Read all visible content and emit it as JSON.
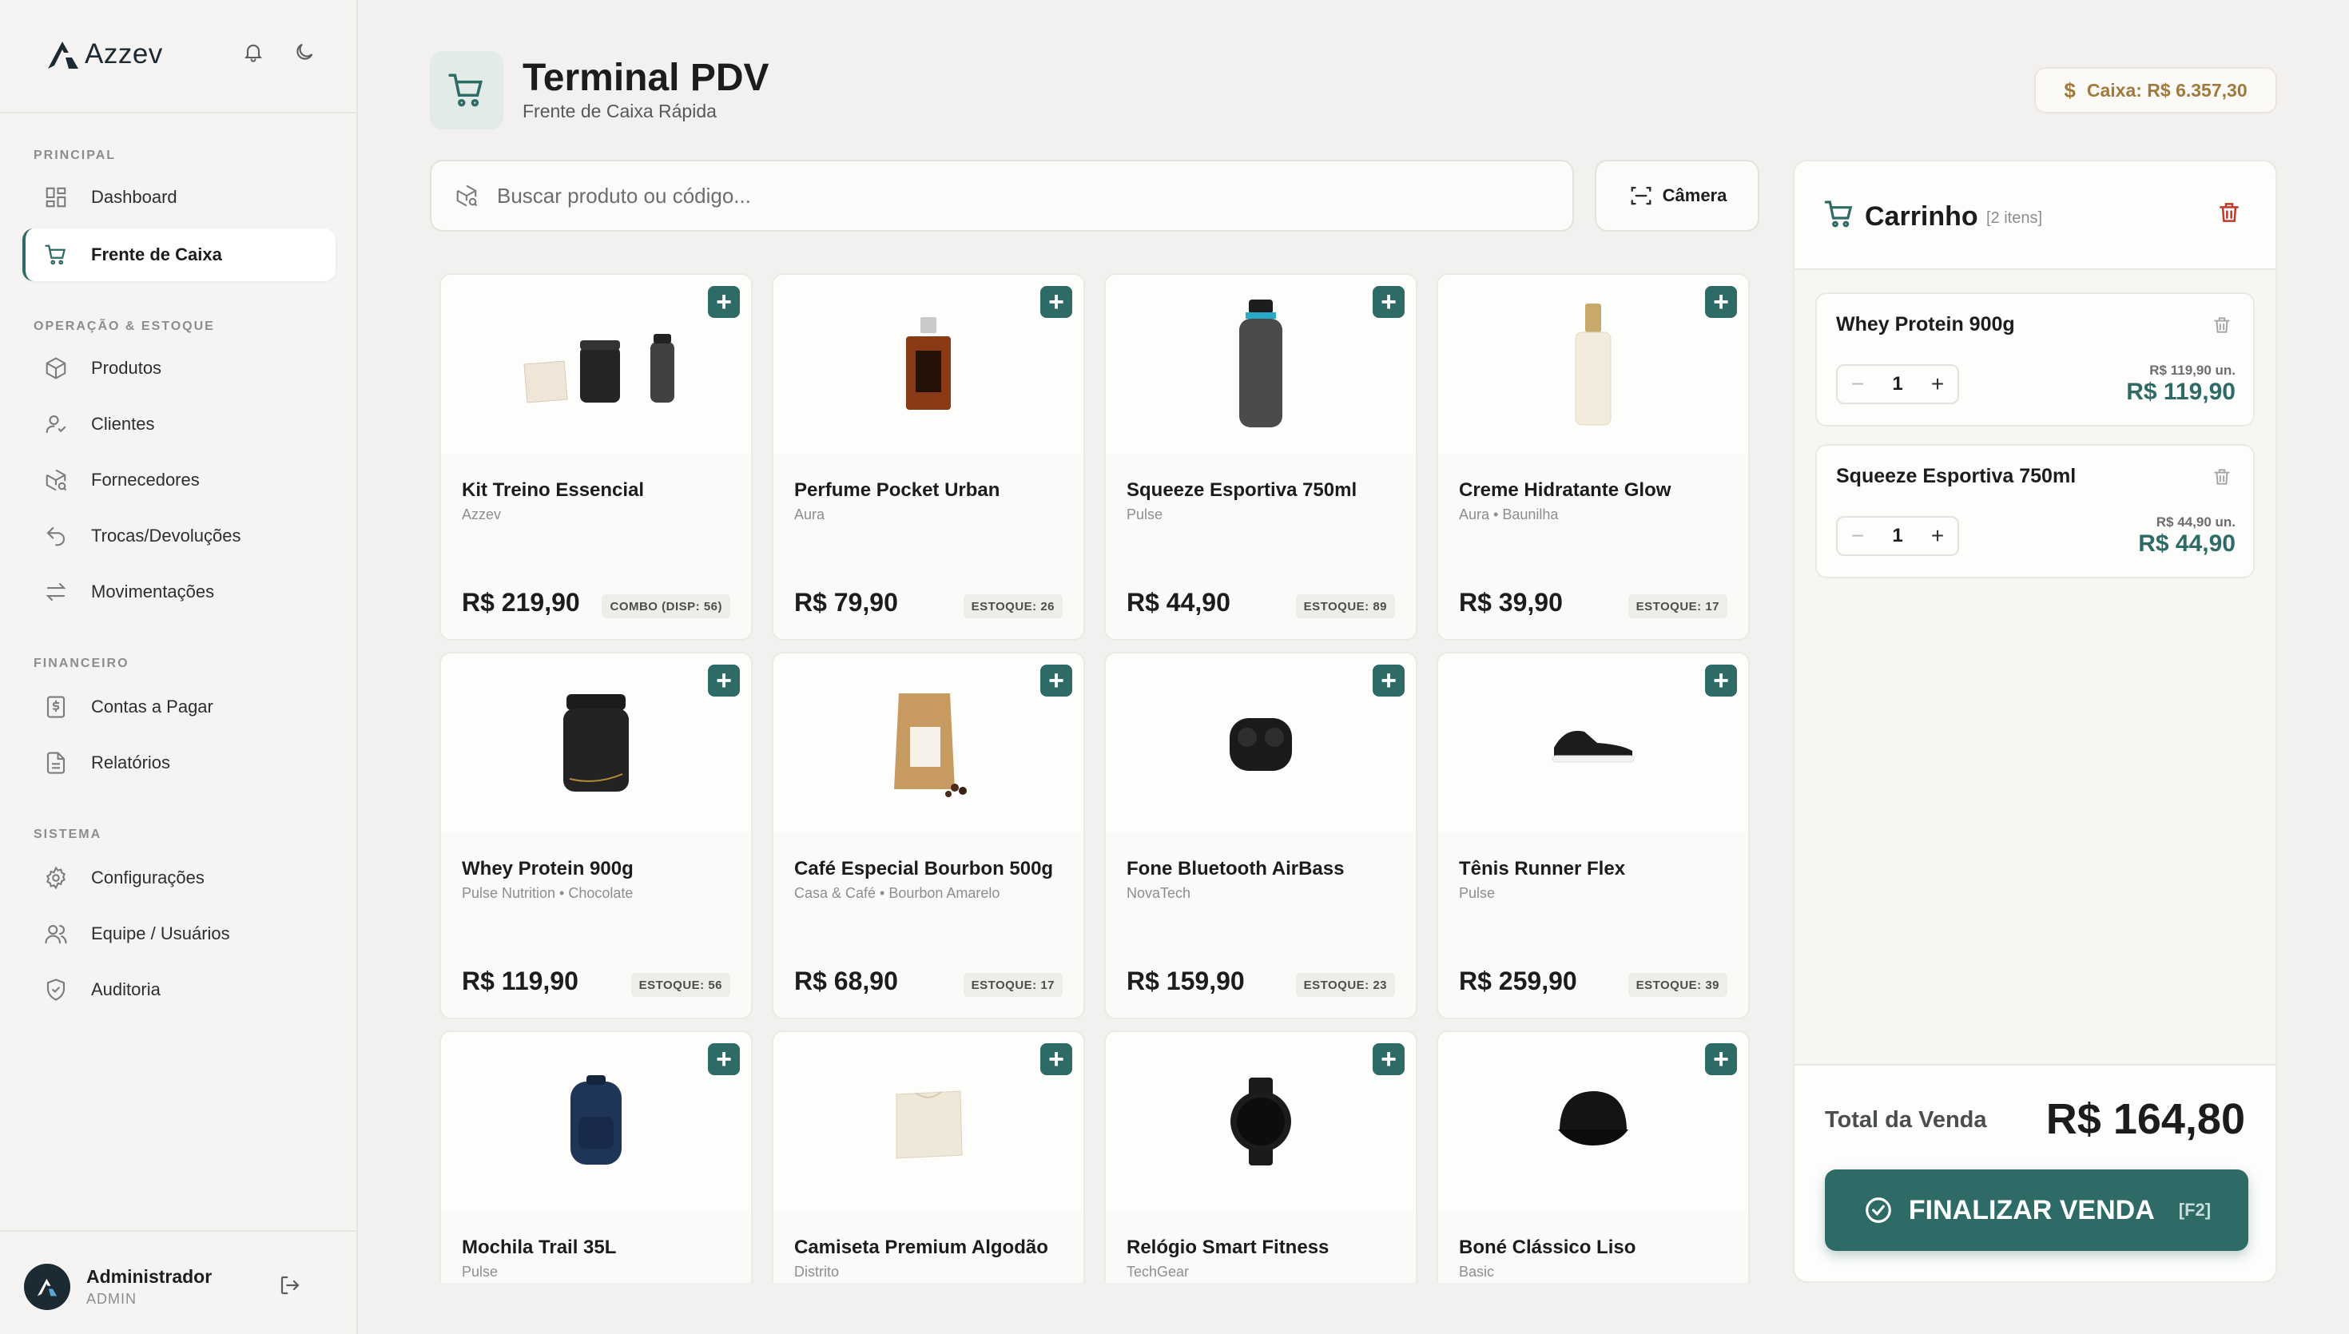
{
  "sidebar": {
    "brand": "Azzev",
    "sections": {
      "principal": "PRINCIPAL",
      "operacao": "OPERAÇÃO & ESTOQUE",
      "financeiro": "FINANCEIRO",
      "sistema": "SISTEMA"
    },
    "items": {
      "dashboard": "Dashboard",
      "frente": "Frente de Caixa",
      "produtos": "Produtos",
      "clientes": "Clientes",
      "fornecedores": "Fornecedores",
      "trocas": "Trocas/Devoluções",
      "movimentacoes": "Movimentações",
      "contas": "Contas a Pagar",
      "relatorios": "Relatórios",
      "configuracoes": "Configurações",
      "equipe": "Equipe / Usuários",
      "auditoria": "Auditoria"
    },
    "user": {
      "name": "Administrador",
      "role": "ADMIN"
    }
  },
  "header": {
    "title": "Terminal PDV",
    "subtitle": "Frente de Caixa Rápida",
    "cash": "Caixa: R$ 6.357,30"
  },
  "search": {
    "placeholder": "Buscar produto ou código...",
    "camera_label": "Câmera"
  },
  "products": [
    {
      "name": "Kit Treino Essencial",
      "brand": "Azzev",
      "price": "R$ 219,90",
      "stock": "COMBO (DISP: 56)",
      "icon": "kit-icon"
    },
    {
      "name": "Perfume Pocket Urban",
      "brand": "Aura",
      "price": "R$ 79,90",
      "stock": "ESTOQUE: 26",
      "icon": "perfume-icon"
    },
    {
      "name": "Squeeze Esportiva 750ml",
      "brand": "Pulse",
      "price": "R$ 44,90",
      "stock": "ESTOQUE: 89",
      "icon": "bottle-icon"
    },
    {
      "name": "Creme Hidratante Glow",
      "brand": "Aura • Baunilha",
      "price": "R$ 39,90",
      "stock": "ESTOQUE: 17",
      "icon": "cream-icon"
    },
    {
      "name": "Whey Protein 900g",
      "brand": "Pulse Nutrition • Chocolate",
      "price": "R$ 119,90",
      "stock": "ESTOQUE: 56",
      "icon": "protein-jar-icon"
    },
    {
      "name": "Café Especial Bourbon 500g",
      "brand": "Casa & Café • Bourbon Amarelo",
      "price": "R$ 68,90",
      "stock": "ESTOQUE: 17",
      "icon": "coffee-bag-icon"
    },
    {
      "name": "Fone Bluetooth AirBass",
      "brand": "NovaTech",
      "price": "R$ 159,90",
      "stock": "ESTOQUE: 23",
      "icon": "earbuds-icon"
    },
    {
      "name": "Tênis Runner Flex",
      "brand": "Pulse",
      "price": "R$ 259,90",
      "stock": "ESTOQUE: 39",
      "icon": "sneaker-icon"
    },
    {
      "name": "Mochila Trail 35L",
      "brand": "Pulse",
      "price": "",
      "stock": "",
      "icon": "backpack-icon"
    },
    {
      "name": "Camiseta Premium Algodão",
      "brand": "Distrito",
      "price": "",
      "stock": "",
      "icon": "tshirt-icon"
    },
    {
      "name": "Relógio Smart Fitness",
      "brand": "TechGear",
      "price": "",
      "stock": "",
      "icon": "smartwatch-icon"
    },
    {
      "name": "Boné Clássico Liso",
      "brand": "Basic",
      "price": "",
      "stock": "",
      "icon": "cap-icon"
    }
  ],
  "cart": {
    "title": "Carrinho",
    "count": "[2 itens]",
    "items": [
      {
        "name": "Whey Protein 900g",
        "qty": "1",
        "unit_price": "R$ 119,90 un.",
        "total": "R$ 119,90"
      },
      {
        "name": "Squeeze Esportiva 750ml",
        "qty": "1",
        "unit_price": "R$ 44,90 un.",
        "total": "R$ 44,90"
      }
    ],
    "total_label": "Total da Venda",
    "total_value": "R$ 164,80",
    "finish_label": "FINALIZAR VENDA",
    "finish_key": "[F2]"
  },
  "colors": {
    "accent": "#2f6b66",
    "cash_text": "#a07a3c",
    "danger": "#c0392b"
  }
}
